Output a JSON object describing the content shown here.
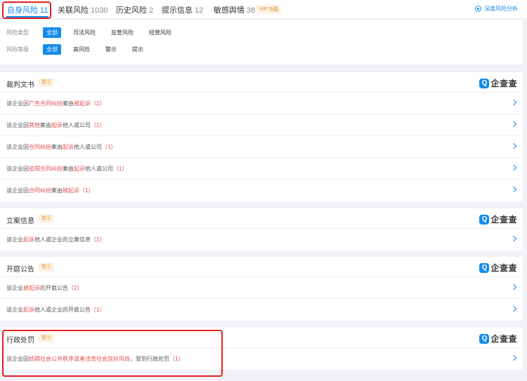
{
  "tabs": [
    {
      "label": "自身风险",
      "count": "11",
      "active": true
    },
    {
      "label": "关联风险",
      "count": "1030"
    },
    {
      "label": "历史风险",
      "count": "2"
    },
    {
      "label": "提示信息",
      "count": "12"
    },
    {
      "label": "敏感舆情",
      "count": "38"
    }
  ],
  "vip_label": "VIP 功能",
  "deep_analysis": "深度风险分析",
  "filters": {
    "type_label": "风险类型",
    "type_options": [
      "全部",
      "司法风险",
      "监管风险",
      "经营风险"
    ],
    "level_label": "风险等级",
    "level_options": [
      "全部",
      "高风险",
      "警示",
      "提示"
    ]
  },
  "logo_text": "企查查",
  "logo_mark": "Q",
  "badge_text": "警示",
  "sections": [
    {
      "title": "裁判文书",
      "rows": [
        [
          "该企业因",
          "广告合同纠纷",
          "案由",
          "被起诉",
          "",
          "（2）"
        ],
        [
          "该企业因",
          "其他",
          "案由",
          "起诉",
          "他人或公司",
          "（1）"
        ],
        [
          "该企业因",
          "合同纠纷",
          "案由",
          "起诉",
          "他人或公司",
          "（1）"
        ],
        [
          "该企业因",
          "追偿合同纠纷",
          "案由",
          "起诉",
          "他人或公司",
          "（1）"
        ],
        [
          "该企业因",
          "合同纠纷",
          "案由",
          "被起诉",
          "",
          "（1）"
        ]
      ]
    },
    {
      "title": "立案信息",
      "rows": [
        [
          "该企业",
          "起诉",
          "他人或企业的立案信息",
          "",
          "",
          "（1）"
        ]
      ]
    },
    {
      "title": "开庭公告",
      "rows": [
        [
          "该企业",
          "被起诉",
          "的开庭公告",
          "",
          "",
          "（2）"
        ],
        [
          "该企业",
          "起诉",
          "他人或企业的开庭公告",
          "",
          "",
          "（1）"
        ]
      ]
    },
    {
      "title": "行政处罚",
      "rows": [
        [
          "该企业因",
          "妨碍社会公共秩序或者违背社会良好风尚",
          "，受到行政处罚",
          "",
          "",
          "（1）"
        ]
      ]
    }
  ],
  "colors": {
    "accent": "#128bed",
    "risk_red": "#e34d4d",
    "highlight": "#e62020"
  }
}
